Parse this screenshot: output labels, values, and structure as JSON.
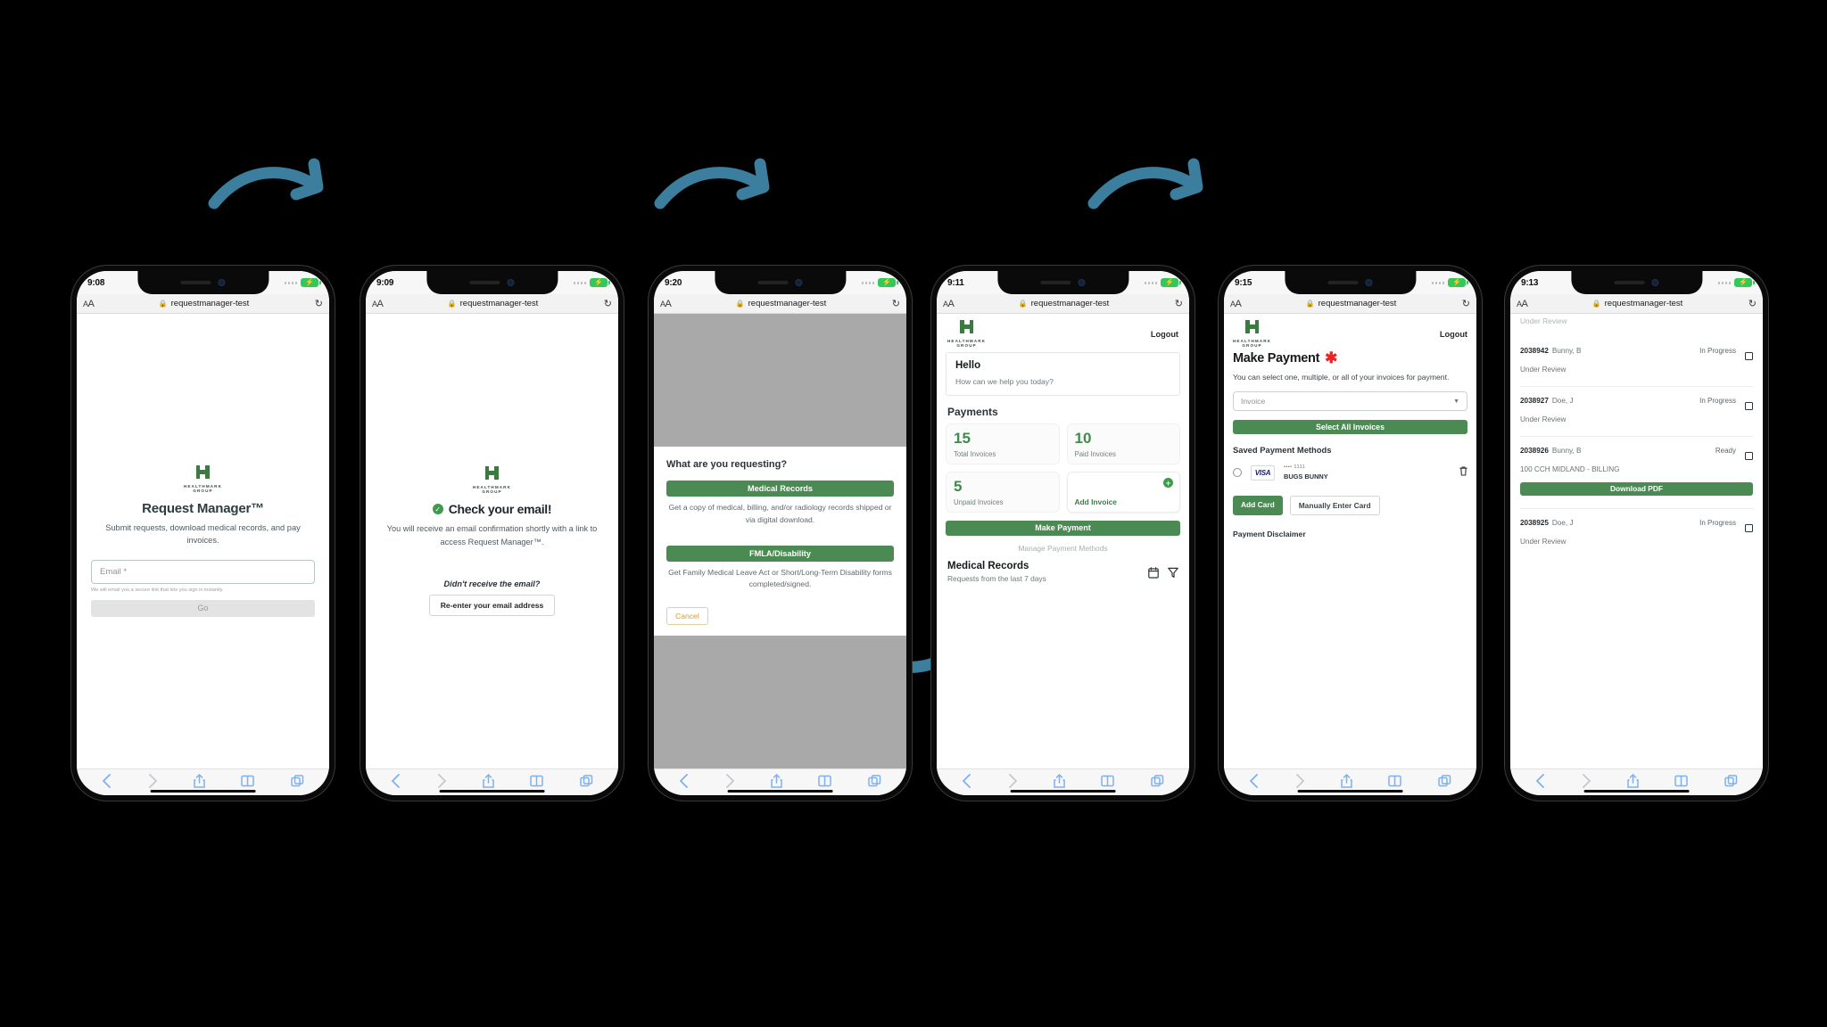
{
  "brand": {
    "logo_word_1": "HEALTHMARK",
    "logo_word_2": "GROUP",
    "accent_green": "#4b8a52",
    "accent_green_dark": "#3c7a41",
    "arrow_blue": "#3c7e9e",
    "required_red": "#f32020"
  },
  "browser": {
    "url": "requestmanager-test",
    "aa_label": "AA",
    "lock_icon": "lock-icon",
    "reload_icon": "reload-icon",
    "back_icon": "back-chevron-icon",
    "forward_icon": "forward-chevron-icon",
    "share_icon": "share-icon",
    "bookmarks_icon": "book-icon",
    "tabs_icon": "tabs-icon"
  },
  "phones": [
    {
      "id": "phone-1-login",
      "time": "9:08",
      "screen": "login",
      "title": "Request Manager™",
      "subtitle": "Submit requests, download medical records, and pay invoices.",
      "email_placeholder": "Email *",
      "hint": "We will email you a secure link that lets you sign in instantly",
      "go_label": "Go"
    },
    {
      "id": "phone-2-check-email",
      "time": "9:09",
      "screen": "check-email",
      "title": "Check your email!",
      "check_icon": "check-circle-icon",
      "body": "You will receive an email confirmation shortly with a link to access Request Manager™.",
      "question": "Didn't receive the email?",
      "reenter_label": "Re-enter your email address"
    },
    {
      "id": "phone-3-request-type",
      "time": "9:20",
      "screen": "request-type-modal",
      "question": "What are you requesting?",
      "options": [
        {
          "label": "Medical Records",
          "description": "Get a copy of medical, billing, and/or radiology records shipped or via digital download."
        },
        {
          "label": "FMLA/Disability",
          "description": "Get Family Medical Leave Act or Short/Long-Term Disability forms completed/signed."
        }
      ],
      "cancel_label": "Cancel"
    },
    {
      "id": "phone-4-dashboard",
      "time": "9:11",
      "screen": "dashboard",
      "logout_label": "Logout",
      "hello": "Hello",
      "hello_sub": "How can we help you today?",
      "payments_heading": "Payments",
      "tiles": [
        {
          "value": "15",
          "label": "Total Invoices"
        },
        {
          "value": "10",
          "label": "Paid Invoices"
        },
        {
          "value": "5",
          "label": "Unpaid Invoices"
        }
      ],
      "add_invoice_label": "Add Invoice",
      "add_invoice_icon": "plus-circle-icon",
      "make_payment_label": "Make Payment",
      "manage_methods_label": "Manage Payment Methods",
      "records_title": "Medical Records",
      "records_sub": "Requests from the last 7 days",
      "calendar_icon": "calendar-icon",
      "filter_icon": "filter-icon"
    },
    {
      "id": "phone-5-make-payment",
      "time": "9:15",
      "screen": "make-payment",
      "logout_label": "Logout",
      "title": "Make Payment",
      "required_marker": "✱",
      "description": "You can select one, multiple, or all of your invoices for payment.",
      "invoice_select_placeholder": "Invoice",
      "select_all_label": "Select All Invoices",
      "saved_methods_heading": "Saved Payment Methods",
      "saved_card": {
        "brand": "VISA",
        "mask": "•••• 1111",
        "name": "BUGS BUNNY",
        "radio_icon": "radio-unselected-icon",
        "delete_icon": "trash-icon"
      },
      "add_card_label": "Add Card",
      "manual_card_label": "Manually Enter Card",
      "disclaimer_label": "Payment Disclaimer"
    },
    {
      "id": "phone-6-requests",
      "time": "9:13",
      "screen": "requests-list",
      "clipped_top_text": "Under Review",
      "requests": [
        {
          "id": "2038942",
          "name": "Bunny, B",
          "sub": "Under Review",
          "status": "In Progress",
          "has_download": false
        },
        {
          "id": "2038927",
          "name": "Doe, J",
          "sub": "Under Review",
          "status": "In Progress",
          "has_download": false
        },
        {
          "id": "2038926",
          "name": "Bunny, B",
          "sub": "100 CCH MIDLAND - BILLING",
          "status": "Ready",
          "has_download": true
        },
        {
          "id": "2038925",
          "name": "Doe, J",
          "sub": "Under Review",
          "status": "In Progress",
          "has_download": false
        }
      ],
      "download_label": "Download PDF",
      "checkbox_icon": "checkbox-unchecked-icon"
    }
  ]
}
